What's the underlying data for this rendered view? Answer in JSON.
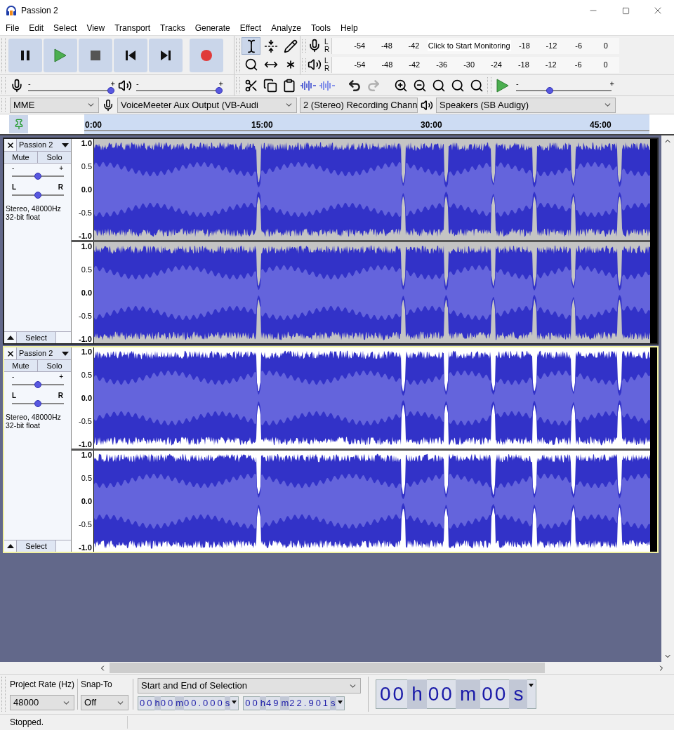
{
  "window": {
    "title": "Passion 2"
  },
  "menu": [
    "File",
    "Edit",
    "Select",
    "View",
    "Transport",
    "Tracks",
    "Generate",
    "Effect",
    "Analyze",
    "Tools",
    "Help"
  ],
  "transport": [
    {
      "kind": "pause"
    },
    {
      "kind": "play"
    },
    {
      "kind": "stop"
    },
    {
      "kind": "skip_start"
    },
    {
      "kind": "skip_end"
    },
    {
      "kind": "record"
    }
  ],
  "tools": [
    {
      "kind": "selection",
      "selected": true
    },
    {
      "kind": "envelope",
      "selected": false
    },
    {
      "kind": "draw",
      "selected": false
    },
    {
      "kind": "zoom",
      "selected": false
    },
    {
      "kind": "time_shift",
      "selected": false
    },
    {
      "kind": "multi",
      "selected": false
    }
  ],
  "meters": [
    {
      "kind": "record",
      "left": "L",
      "right": "R",
      "ticks_before": [
        "-54",
        "-48",
        "-42"
      ],
      "prompt": "Click to Start Monitoring",
      "ticks_after": [
        "-18",
        "-12",
        "-6",
        "0"
      ]
    },
    {
      "kind": "playback",
      "left": "L",
      "right": "R",
      "ticks_before": [
        "-54",
        "-48",
        "-42",
        "-36",
        "-30",
        "-24",
        "-18",
        "-12",
        "-6",
        "0"
      ]
    }
  ],
  "mixer": [
    {
      "kind": "record",
      "min_label": "-",
      "max_label": "+",
      "level": 1.0
    },
    {
      "kind": "playback",
      "min_label": "-",
      "max_label": "+",
      "level": 1.0
    }
  ],
  "edit": [
    {
      "kind": "cut"
    },
    {
      "kind": "copy"
    },
    {
      "kind": "paste"
    },
    {
      "kind": "trim"
    },
    {
      "kind": "silence"
    }
  ],
  "history": [
    {
      "kind": "undo",
      "disabled": false
    },
    {
      "kind": "redo",
      "disabled": true
    }
  ],
  "zoom": [
    {
      "kind": "zoom_in"
    },
    {
      "kind": "zoom_out"
    },
    {
      "kind": "fit_selection"
    },
    {
      "kind": "fit_project"
    },
    {
      "kind": "zoom_toggle"
    }
  ],
  "play_at_speed": {
    "min_label": "-",
    "max_label": "+",
    "level": 0.35
  },
  "devices": {
    "host": "MME",
    "recording_device": "VoiceMeeter Aux Output (VB-Audi",
    "channels": "2 (Stereo) Recording Chann",
    "playback_device": "Speakers (SB Audigy)"
  },
  "ruler": {
    "labels": [
      "0:00",
      "15:00",
      "30:00",
      "45:00"
    ]
  },
  "tracks": [
    {
      "name": "Passion 2",
      "selected": false,
      "mute": "Mute",
      "solo": "Solo",
      "gain": {
        "min_label": "-",
        "max_label": "+",
        "level": 0.5
      },
      "pan": {
        "left_label": "L",
        "right_label": "R",
        "level": 0.5
      },
      "info": [
        "Stereo, 48000Hz",
        "32-bit float"
      ],
      "select_label": "Select",
      "channels": [
        {
          "scale": [
            "1.0",
            "0.5",
            "0.0",
            "-0.5",
            "-1.0"
          ]
        },
        {
          "scale": [
            "1.0",
            "0.5",
            "0.0",
            "-0.5",
            "-1.0"
          ]
        }
      ]
    },
    {
      "name": "Passion 2",
      "selected": true,
      "mute": "Mute",
      "solo": "Solo",
      "gain": {
        "min_label": "-",
        "max_label": "+",
        "level": 0.5
      },
      "pan": {
        "left_label": "L",
        "right_label": "R",
        "level": 0.5
      },
      "info": [
        "Stereo, 48000Hz",
        "32-bit float"
      ],
      "select_label": "Select",
      "channels": [
        {
          "scale": [
            "1.0",
            "0.5",
            "0.0",
            "-0.5",
            "-1.0"
          ]
        },
        {
          "scale": [
            "1.0",
            "0.5",
            "0.0",
            "-0.5",
            "-1.0"
          ]
        }
      ]
    }
  ],
  "selection_toolbar": {
    "project_rate": {
      "label": "Project Rate (Hz)",
      "value": "48000"
    },
    "snap_to": {
      "label": "Snap-To",
      "value": "Off"
    },
    "mode": "Start and End of Selection",
    "start": [
      {
        "value": "00",
        "unit": "h"
      },
      {
        "value": "00",
        "unit": "m"
      },
      {
        "value": "00.000",
        "unit": "s"
      }
    ],
    "end": [
      {
        "value": "00",
        "unit": "h"
      },
      {
        "value": "49",
        "unit": "m"
      },
      {
        "value": "22.901",
        "unit": "s"
      }
    ],
    "position": [
      {
        "value": "00",
        "unit": "h"
      },
      {
        "value": "00",
        "unit": "m"
      },
      {
        "value": "00",
        "unit": "s"
      }
    ]
  },
  "status_bar": {
    "text": "Stopped."
  }
}
